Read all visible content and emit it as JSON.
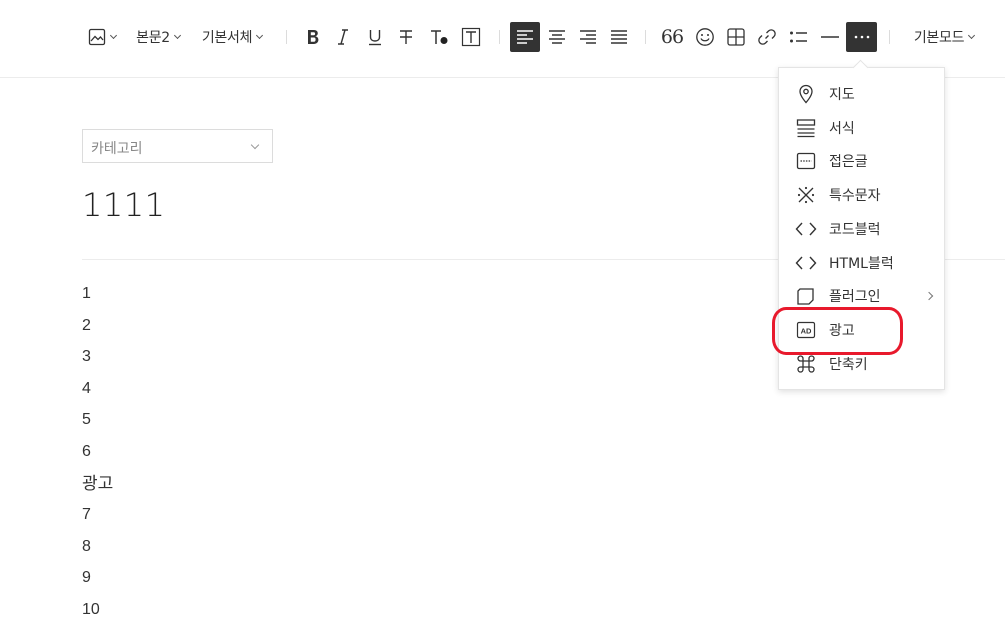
{
  "toolbar": {
    "paragraph_style": "본문2",
    "font": "기본서체",
    "mode": "기본모드"
  },
  "editor": {
    "category_placeholder": "카테고리",
    "title": "1111",
    "lines": [
      "1",
      "2",
      "3",
      "4",
      "5",
      "6",
      "광고",
      "7",
      "8",
      "9",
      "10"
    ]
  },
  "more_menu": {
    "items": [
      {
        "label": "지도",
        "icon": "map-pin-icon"
      },
      {
        "label": "서식",
        "icon": "template-icon"
      },
      {
        "label": "접은글",
        "icon": "fold-icon"
      },
      {
        "label": "특수문자",
        "icon": "special-char-icon"
      },
      {
        "label": "코드블럭",
        "icon": "code-icon"
      },
      {
        "label": "HTML블럭",
        "icon": "html-icon"
      },
      {
        "label": "플러그인",
        "icon": "plugin-icon"
      },
      {
        "label": "광고",
        "icon": "ad-icon"
      },
      {
        "label": "단축키",
        "icon": "command-icon"
      }
    ]
  },
  "colors": {
    "highlight": "#e8192c",
    "active_button": "#333333"
  }
}
